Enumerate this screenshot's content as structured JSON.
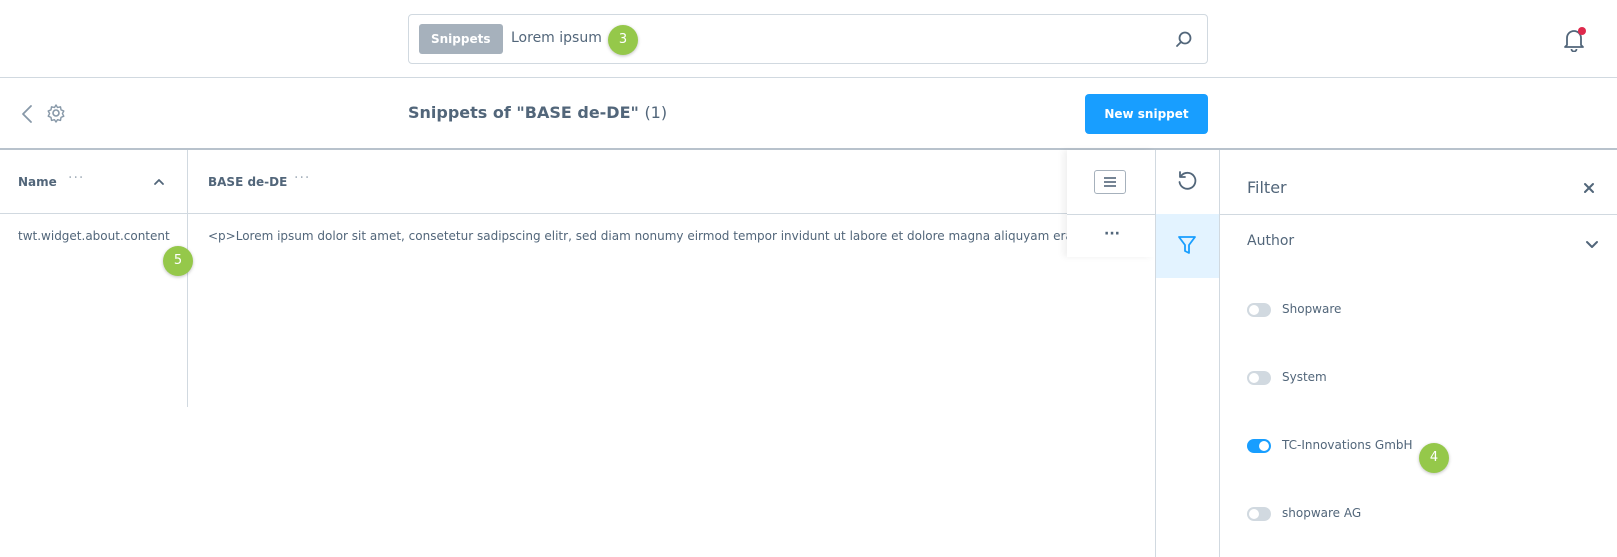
{
  "search": {
    "tag": "Snippets",
    "value": "Lorem ipsum",
    "marker": "3"
  },
  "header": {
    "title": "Snippets of \"BASE de-DE\"",
    "count": "(1)",
    "new_button": "New snippet"
  },
  "grid": {
    "columns": [
      {
        "label": "Name",
        "dots": "···"
      },
      {
        "label": "BASE de-DE",
        "dots": "···"
      }
    ],
    "row_actions": "···",
    "rows": [
      {
        "name": "twt.widget.about.content",
        "value": "<p>Lorem ipsum dolor sit amet, consetetur sadipscing elitr, sed diam nonumy eirmod tempor invidunt ut labore et dolore magna aliquyam erat, sed diam voluptua.</p>",
        "marker": "5"
      }
    ]
  },
  "filter": {
    "title": "Filter",
    "group": "Author",
    "marker": "4",
    "options": [
      {
        "label": "Shopware",
        "active": false
      },
      {
        "label": "System",
        "active": false
      },
      {
        "label": "TC-Innovations GmbH",
        "active": true
      },
      {
        "label": "shopware AG",
        "active": false
      }
    ]
  },
  "colors": {
    "accent": "#189eff",
    "marker": "#95c84a",
    "notification": "#de294c"
  },
  "icons": {
    "search": "search-icon",
    "bell": "bell-icon",
    "back": "chevron-left-icon",
    "settings": "gear-icon",
    "sort": "chevron-up-icon",
    "columns": "list-icon",
    "refresh": "refresh-icon",
    "filter": "filter-icon",
    "close": "close-icon",
    "expand": "chevron-down-icon"
  }
}
